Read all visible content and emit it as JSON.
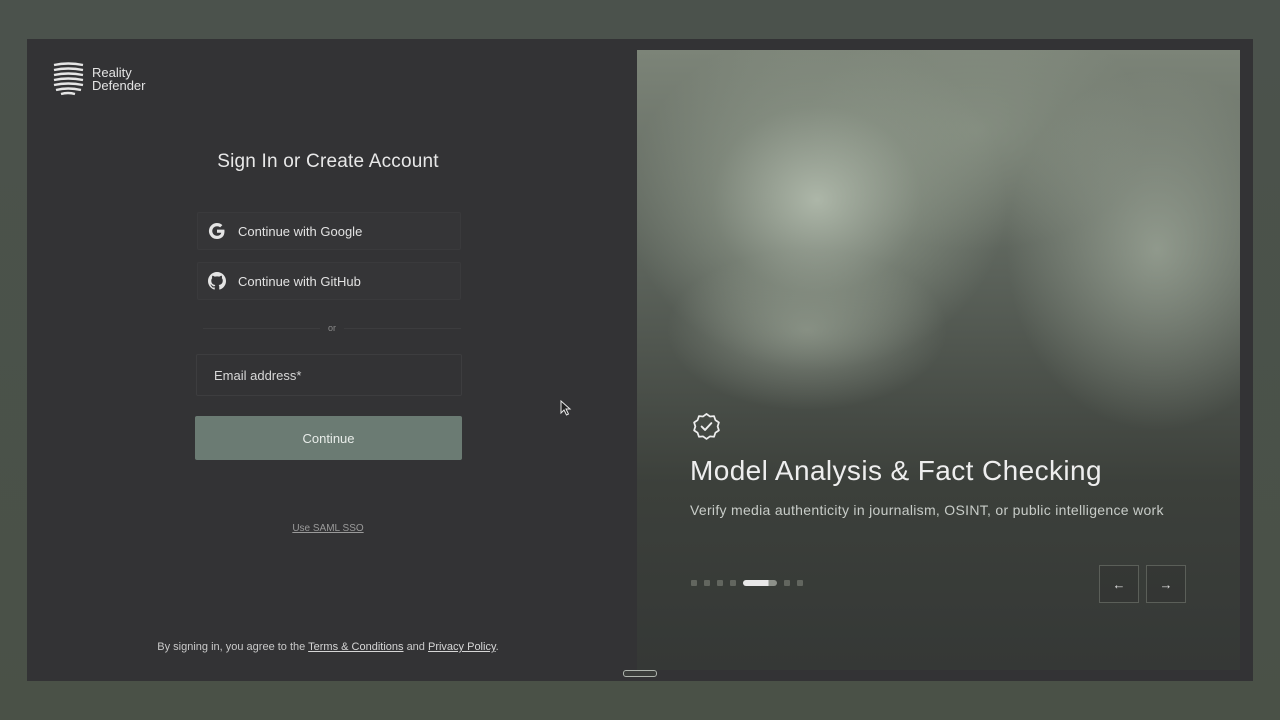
{
  "brand": {
    "line1": "Reality",
    "line2": "Defender"
  },
  "auth": {
    "title": "Sign In or Create Account",
    "google_label": "Continue with Google",
    "github_label": "Continue with GitHub",
    "divider_text": "or",
    "email_placeholder": "Email address*",
    "continue_label": "Continue",
    "saml_label": "Use SAML SSO"
  },
  "legal": {
    "prefix": "By signing in, you agree to the",
    "terms": "Terms & Conditions",
    "and": "and",
    "privacy": "Privacy Policy",
    "suffix": "."
  },
  "carousel": {
    "title": "Model Analysis & Fact Checking",
    "subtitle": "Verify media authenticity in journalism, OSINT, or public intelligence work",
    "slide_count": 7,
    "active_index": 4,
    "prev_icon": "arrow-left-icon",
    "next_icon": "arrow-right-icon",
    "prev_glyph": "←",
    "next_glyph": "→"
  },
  "colors": {
    "background": "#333335",
    "accent": "#6b7b73",
    "text": "#e8e8e8"
  }
}
